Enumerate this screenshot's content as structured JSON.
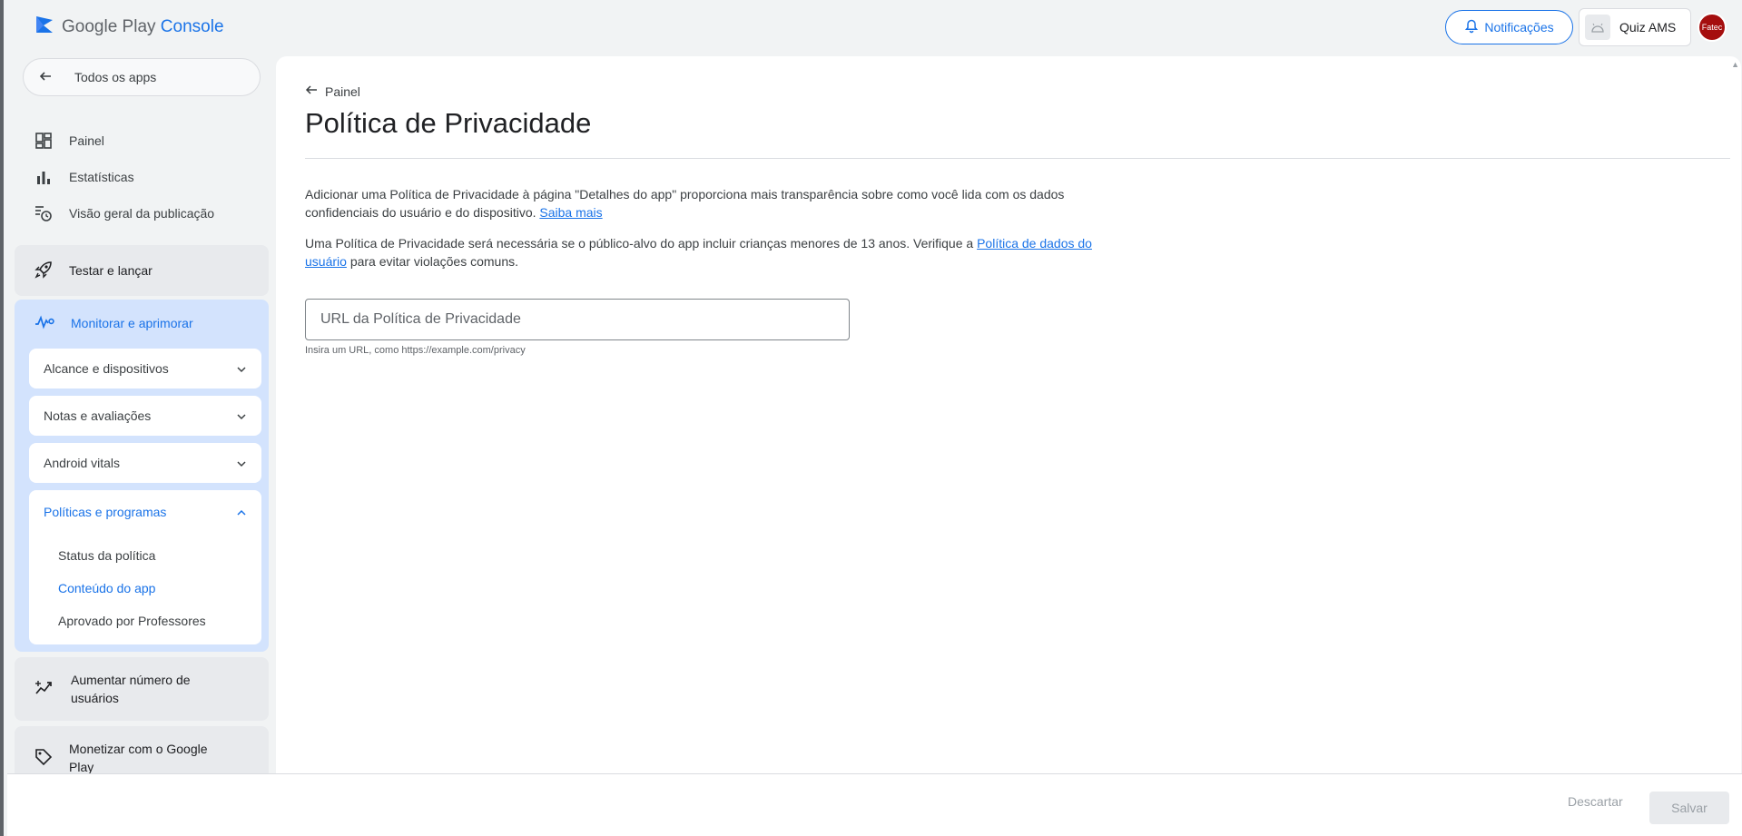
{
  "header": {
    "logo_text_google_play": "Google Play",
    "logo_text_console": "Console",
    "notifications_label": "Notificações",
    "app_name": "Quiz AMS",
    "avatar_text": "Fatec"
  },
  "sidebar": {
    "all_apps_label": "Todos os apps",
    "nav": [
      {
        "label": "Painel",
        "icon": "dashboard-icon"
      },
      {
        "label": "Estatísticas",
        "icon": "bar-chart-icon"
      },
      {
        "label": "Visão geral da publicação",
        "icon": "publishing-overview-icon"
      }
    ],
    "test_release_label": "Testar e lançar",
    "monitor_label": "Monitorar e aprimorar",
    "monitor_items": [
      {
        "label": "Alcance e dispositivos"
      },
      {
        "label": "Notas e avaliações"
      },
      {
        "label": "Android vitals"
      }
    ],
    "policies_label": "Políticas e programas",
    "policies_items": [
      {
        "label": "Status da política"
      },
      {
        "label": "Conteúdo do app"
      },
      {
        "label": "Aprovado por Professores"
      }
    ],
    "grow_label": "Aumentar número de usuários",
    "monetize_label": "Monetizar com o Google Play"
  },
  "main": {
    "back_label": "Painel",
    "title": "Política de Privacidade",
    "para1_text": "Adicionar uma Política de Privacidade à página \"Detalhes do app\" proporciona mais transparência sobre como você lida com os dados confidenciais do usuário e do dispositivo.",
    "para1_link": "Saiba mais",
    "para2_text": "Uma Política de Privacidade será necessária se o público-alvo do app incluir crianças menores de 13 anos. Verifique a",
    "para2_link": "Política de dados do usuário",
    "para2_tail": "para evitar violações comuns.",
    "url_placeholder": "URL da Política de Privacidade",
    "url_value": "",
    "helper_text": "Insira um URL, como https://example.com/privacy"
  },
  "footer": {
    "discard_label": "Descartar",
    "save_label": "Salvar"
  },
  "colors": {
    "accent": "#1a73e8",
    "active_section_bg": "#d3e3fd",
    "avatar_bg": "#a50e0e"
  }
}
